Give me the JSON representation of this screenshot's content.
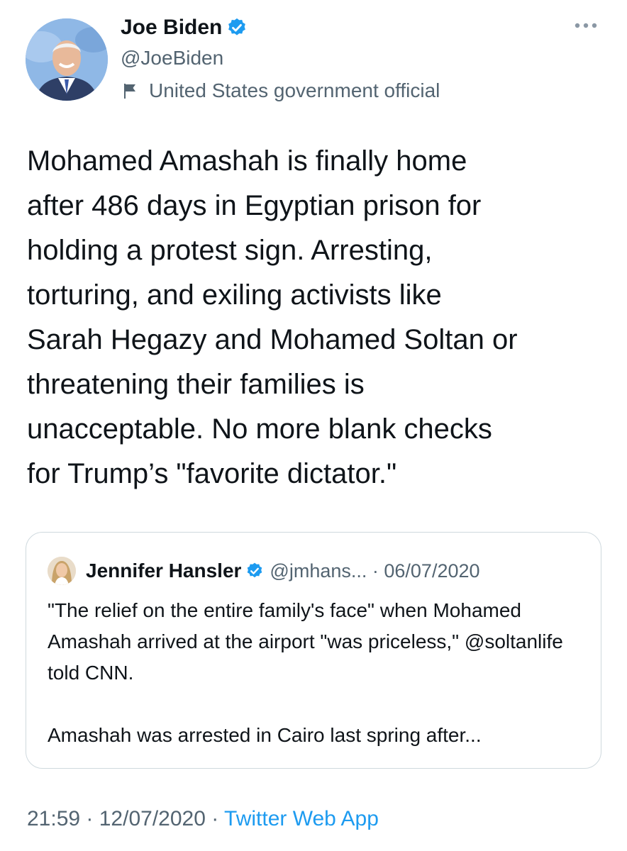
{
  "author": {
    "name": "Joe Biden",
    "handle": "@JoeBiden",
    "label": "United States government official",
    "verified": true
  },
  "tweet": {
    "text": "Mohamed Amashah is finally home\nafter 486 days in Egyptian prison for\nholding a protest sign. Arresting,\ntorturing, and exiling activists like\nSarah Hegazy and Mohamed Soltan or\nthreatening their families is\nunacceptable. No more blank checks\nfor Trump’s \"favorite dictator.\"",
    "time": "21:59",
    "date": "12/07/2020",
    "source": "Twitter Web App"
  },
  "quoted": {
    "name": "Jennifer Hansler",
    "handle": "@jmhans...",
    "date": "06/07/2020",
    "text_p1": "\"The relief on the entire family's face\" when Mohamed Amashah arrived at the airport \"was priceless,\" @soltanlife told CNN.",
    "text_p2": "Amashah was arrested in Cairo last spring after..."
  },
  "colors": {
    "accent": "#1d9bf0",
    "secondary_text": "#536471",
    "border": "#cfd9de"
  },
  "icons": [
    "verified-badge-icon",
    "flag-icon",
    "more-options-icon"
  ]
}
